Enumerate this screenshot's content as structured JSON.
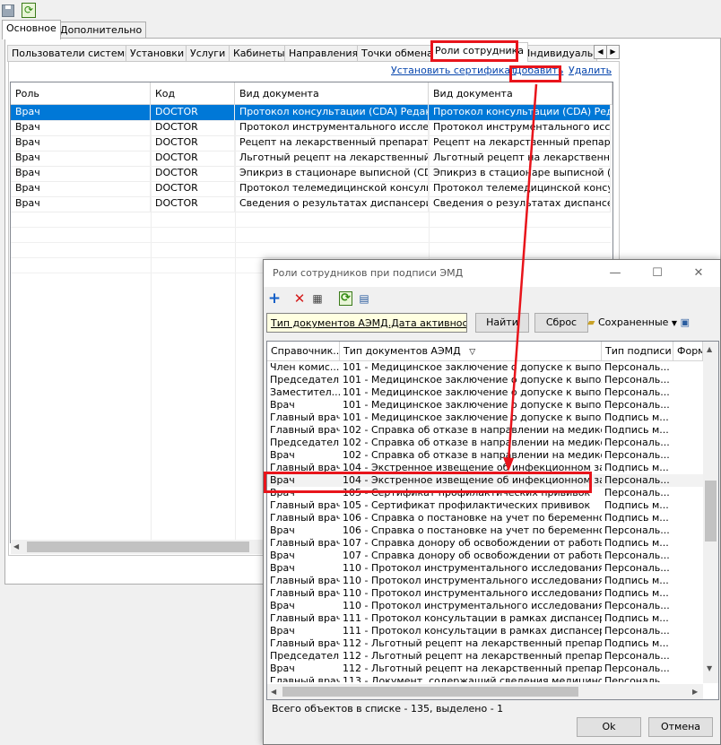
{
  "top_tabs": [
    "Основное",
    "Дополнительно"
  ],
  "tabs": [
    "Пользователи системы",
    "Установки",
    "Услуги",
    "Кабинеты",
    "Направления",
    "Точки обмена",
    "Роли сотрудника",
    "Индивидуальны"
  ],
  "links": {
    "set_cert": "Установить сертификат",
    "add": "Добавить",
    "delete": "Удалить"
  },
  "grid1": {
    "headers": [
      "Роль",
      "Код",
      "Вид документа",
      "Вид документа"
    ],
    "rows": [
      [
        "Врач",
        "DOCTOR",
        "Протокол консультации (CDA) Редакц...",
        "Протокол консультации (CDA) Редакц..."
      ],
      [
        "Врач",
        "DOCTOR",
        "Протокол инструментального исследо...",
        "Протокол инструментального исследо..."
      ],
      [
        "Врач",
        "DOCTOR",
        "Рецепт на лекарственный препарат (С...",
        "Рецепт на лекарственный препарат (С..."
      ],
      [
        "Врач",
        "DOCTOR",
        "Льготный рецепт на лекарственный п...",
        "Льготный рецепт на лекарственный п..."
      ],
      [
        "Врач",
        "DOCTOR",
        "Эпикриз в стационаре выписной (CDA)",
        "Эпикриз в стационаре выписной (CDA)"
      ],
      [
        "Врач",
        "DOCTOR",
        "Протокол телемедицинской консульт...",
        "Протокол телемедицинской консульт..."
      ],
      [
        "Врач",
        "DOCTOR",
        "Сведения о результатах диспансериз...",
        "Сведения о результатах диспансериз..."
      ]
    ]
  },
  "dialog": {
    "title": "Роли сотрудников при подписи ЭМД",
    "filter_text": "Тип документов АЭМД.Дата активност...",
    "find_button": "Найти",
    "reset_button": "Сброс",
    "saved_label": "Сохраненные",
    "headers": [
      "Справочник...",
      "Тип документов АЭМД",
      "Тип подписи",
      "Форм"
    ],
    "rows": [
      [
        "Член комис...",
        "101 - Медицинское заключение о допуске к выполне...",
        "Персональ..."
      ],
      [
        "Председатель",
        "101 - Медицинское заключение о допуске к выполне...",
        "Персональ..."
      ],
      [
        "Заместител...",
        "101 - Медицинское заключение о допуске к выполне...",
        "Персональ..."
      ],
      [
        "Врач",
        "101 - Медицинское заключение о допуске к выполне...",
        "Персональ..."
      ],
      [
        "Главный врач",
        "101 - Медицинское заключение о допуске к выполне...",
        "Подпись м..."
      ],
      [
        "Главный врач",
        "102 - Справка об отказе в направлении на медико-с...",
        "Подпись м..."
      ],
      [
        "Председатель",
        "102 - Справка об отказе в направлении на медико-с...",
        "Персональ..."
      ],
      [
        "Врач",
        "102 - Справка об отказе в направлении на медико-с...",
        "Персональ..."
      ],
      [
        "Главный врач",
        "104 - Экстренное извещение об инфекционном забо...",
        "Подпись м..."
      ],
      [
        "Врач",
        "104 - Экстренное извещение об инфекционном забо...",
        "Персональ..."
      ],
      [
        "Врач",
        "105 - Сертификат профилактических прививок",
        "Персональ..."
      ],
      [
        "Главный врач",
        "105 - Сертификат профилактических прививок",
        "Подпись м..."
      ],
      [
        "Главный врач",
        "106 - Справка о постановке на учет по беременности",
        "Подпись м..."
      ],
      [
        "Врач",
        "106 - Справка о постановке на учет по беременности",
        "Персональ..."
      ],
      [
        "Главный врач",
        "107 - Справка донору об освобождении от работы в ...",
        "Подпись м..."
      ],
      [
        "Врач",
        "107 - Справка донору об освобождении от работы в ...",
        "Персональ..."
      ],
      [
        "Врач",
        "110 - Протокол инструментального исследования (С...",
        "Персональ..."
      ],
      [
        "Главный врач",
        "110 - Протокол инструментального исследования (С...",
        "Подпись м..."
      ],
      [
        "Главный врач",
        "110 - Протокол инструментального исследования Ф...",
        "Подпись м..."
      ],
      [
        "Врач",
        "110 - Протокол инструментального исследования Ф...",
        "Персональ..."
      ],
      [
        "Главный врач",
        "111 - Протокол консультации в рамках диспансерно...",
        "Подпись м..."
      ],
      [
        "Врач",
        "111 - Протокол консультации в рамках диспансерно...",
        "Персональ..."
      ],
      [
        "Главный врач",
        "112 - Льготный рецепт на лекарственный препарат, ...",
        "Подпись м..."
      ],
      [
        "Председатель",
        "112 - Льготный рецепт на лекарственный препарат, ...",
        "Персональ..."
      ],
      [
        "Врач",
        "112 - Льготный рецепт на лекарственный препарат, ...",
        "Персональ..."
      ],
      [
        "Главный врач",
        "113 - Документ, содержащий сведения медицинског...",
        "Персональ..."
      ]
    ],
    "status": "Всего объектов в списке - 135, выделено - 1",
    "ok_button": "Ok",
    "cancel_button": "Отмена"
  },
  "icons": [
    "save-icon",
    "refresh-icon",
    "add-icon",
    "delete-icon",
    "properties-icon",
    "refresh-icon",
    "export-icon",
    "sort-down-icon",
    "dropdown-icon",
    "minimize-icon",
    "maximize-icon",
    "close-icon"
  ],
  "colors": {
    "selection": "#0078d7",
    "highlight_box": "#e8141b",
    "link": "#0645ad",
    "filter_bg": "#ffffe1"
  }
}
